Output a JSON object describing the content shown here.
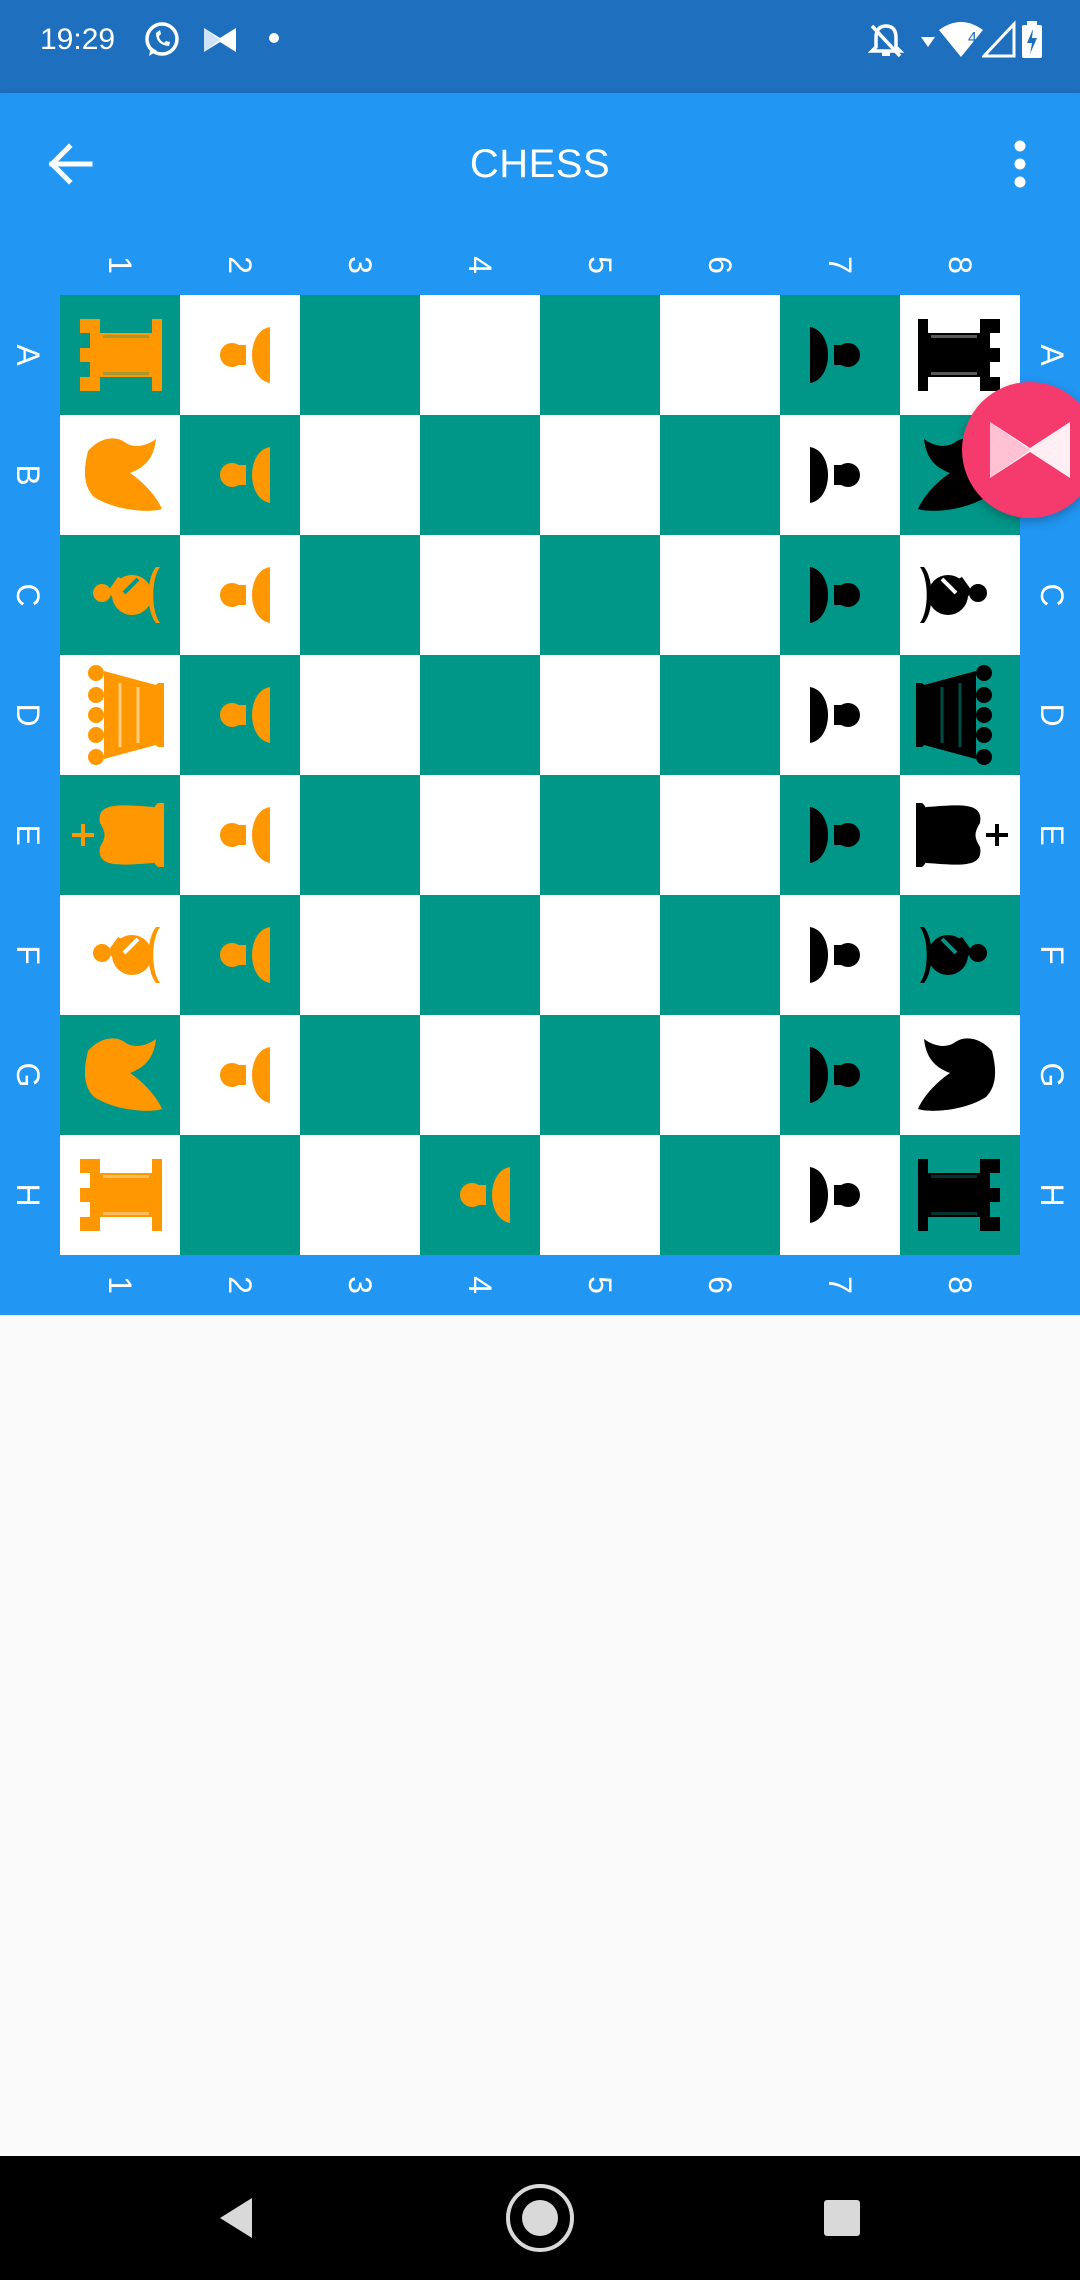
{
  "status_bar": {
    "time": "19:29",
    "left_icons": [
      "whatsapp-icon",
      "musixmatch-icon",
      "dot-icon"
    ],
    "right_icons": [
      "bell-off-icon",
      "data-arrow-icon",
      "wifi-icon",
      "signal-icon",
      "battery-charging-icon"
    ],
    "network_label": "4"
  },
  "app_bar": {
    "title": "CHESS",
    "back_icon": "arrow-left-icon",
    "menu_icon": "more-vert-icon"
  },
  "board": {
    "col_labels": [
      "1",
      "2",
      "3",
      "4",
      "5",
      "6",
      "7",
      "8"
    ],
    "row_labels": [
      "A",
      "B",
      "C",
      "D",
      "E",
      "F",
      "G",
      "H"
    ],
    "colors": {
      "dark_square": "#009688",
      "light_square": "#FFFFFF",
      "frame": "#2196F3",
      "white_pieces": "#FF9800",
      "black_pieces": "#000000"
    },
    "layout": [
      [
        "wR",
        "wP",
        "",
        "",
        "",
        "",
        "bP",
        "bR"
      ],
      [
        "wN",
        "wP",
        "",
        "",
        "",
        "",
        "bP",
        "bN"
      ],
      [
        "wB",
        "wP",
        "",
        "",
        "",
        "",
        "bP",
        "bB"
      ],
      [
        "wQ",
        "wP",
        "",
        "",
        "",
        "",
        "bP",
        "bQ"
      ],
      [
        "wK",
        "wP",
        "",
        "",
        "",
        "",
        "bP",
        "bK"
      ],
      [
        "wB",
        "wP",
        "",
        "",
        "",
        "",
        "bP",
        "bB"
      ],
      [
        "wN",
        "wP",
        "",
        "",
        "",
        "",
        "bP",
        "bN"
      ],
      [
        "wR",
        "",
        "",
        "wP",
        "",
        "",
        "bP",
        "bR"
      ]
    ],
    "piece_names": {
      "K": "king",
      "Q": "queen",
      "R": "rook",
      "B": "bishop",
      "N": "knight",
      "P": "pawn"
    }
  },
  "floating_bubble": {
    "icon": "musixmatch-icon",
    "color": "#F53B6E"
  },
  "nav_bar": {
    "buttons": [
      "back-triangle-icon",
      "home-circle-icon",
      "recents-square-icon"
    ]
  }
}
